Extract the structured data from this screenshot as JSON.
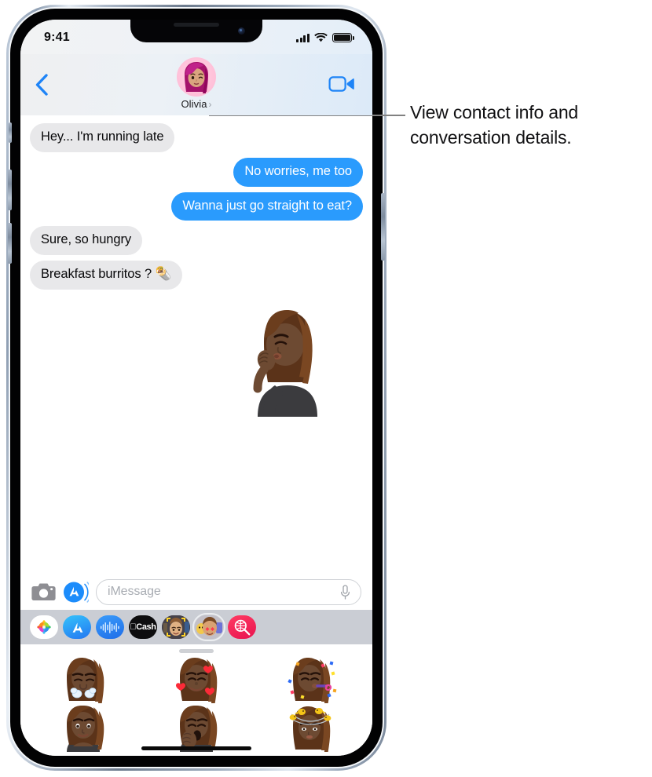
{
  "device": {
    "frame": "iphone",
    "accent": "#2a9bfd"
  },
  "status_bar": {
    "time": "9:41",
    "cellular_icon": "signal-bars-icon",
    "wifi_icon": "wifi-icon",
    "battery_icon": "battery-icon"
  },
  "nav": {
    "back_icon": "back-chevron-icon",
    "facetime_icon": "facetime-video-icon",
    "contact_name": "Olivia",
    "contact_chevron": "›",
    "avatar_icon": "memoji-avatar-olivia"
  },
  "conversation": {
    "messages": [
      {
        "text": "Hey... I'm running late",
        "direction": "in",
        "tail": true
      },
      {
        "text": "No worries, me too",
        "direction": "out",
        "tail": false
      },
      {
        "text": "Wanna just go straight to eat?",
        "direction": "out",
        "tail": true
      },
      {
        "text": "Sure, so hungry",
        "direction": "in",
        "tail": false
      },
      {
        "text": "Breakfast burritos ? 🌯",
        "direction": "in",
        "tail": true
      }
    ],
    "sticker": {
      "name": "memoji-sticker-chefs-kiss",
      "direction": "out"
    }
  },
  "composer": {
    "camera_icon": "camera-icon",
    "appstore_icon": "app-store-icon",
    "placeholder": "iMessage",
    "value": "",
    "mic_icon": "microphone-icon"
  },
  "app_drawer": {
    "apps": [
      {
        "name": "photos-app-icon",
        "label": "Photos",
        "selected": false
      },
      {
        "name": "app-store-app-icon",
        "label": "App Store",
        "selected": false
      },
      {
        "name": "music-waveform-app-icon",
        "label": "Music",
        "selected": false
      },
      {
        "name": "apple-cash-app-icon",
        "label": "Cash",
        "selected": false
      },
      {
        "name": "memoji-camera-app-icon",
        "label": "Memoji Camera",
        "selected": false
      },
      {
        "name": "memoji-stickers-app-icon",
        "label": "Memoji Stickers",
        "selected": true
      },
      {
        "name": "images-search-app-icon",
        "label": "#images",
        "selected": false
      }
    ]
  },
  "sticker_panel": {
    "drag_handle": "drag-handle",
    "stickers": [
      {
        "name": "memoji-sticker-steam-nose",
        "pose": "angry-steam"
      },
      {
        "name": "memoji-sticker-hearts",
        "pose": "smiling-hearts"
      },
      {
        "name": "memoji-sticker-party",
        "pose": "party-horn-confetti"
      },
      {
        "name": "memoji-sticker-smile",
        "pose": "smiling-hands"
      },
      {
        "name": "memoji-sticker-yawn",
        "pose": "yawning"
      },
      {
        "name": "memoji-sticker-birds",
        "pose": "dizzy-birds"
      }
    ]
  },
  "callout": {
    "text": "View contact info and conversation details.",
    "line_color": "#818181"
  }
}
